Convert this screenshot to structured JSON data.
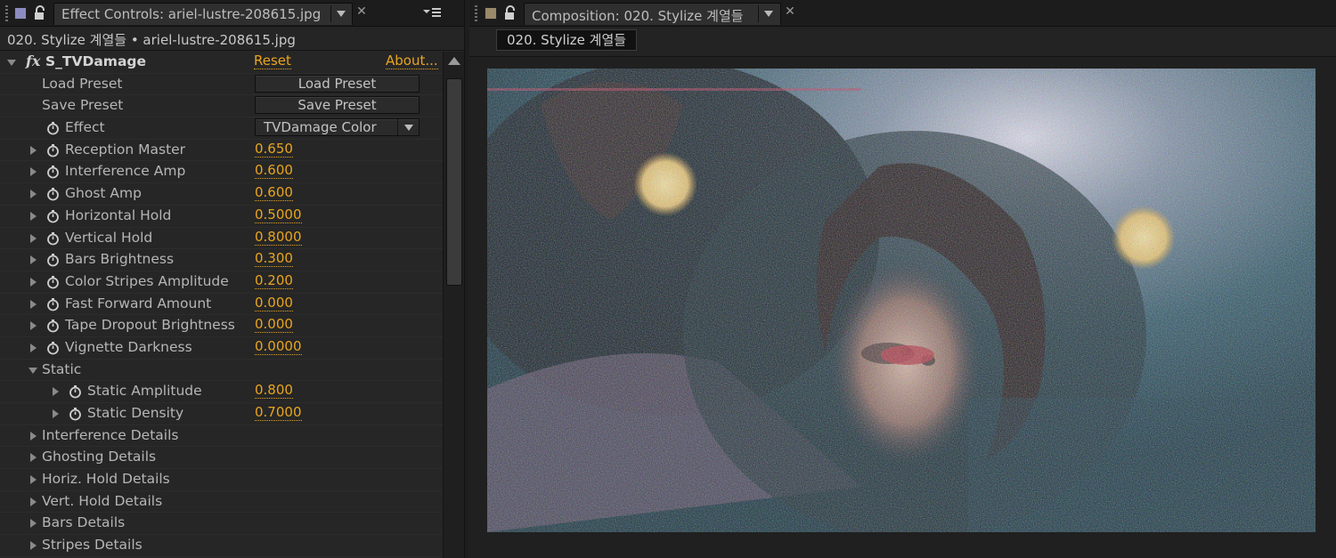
{
  "effect_controls": {
    "tab_title": "Effect Controls: ariel-lustre-208615.jpg",
    "source_line": "020. Stylize 계열들 • ariel-lustre-208615.jpg",
    "effect_name": "S_TVDamage",
    "fx_label": "fx",
    "reset_label": "Reset",
    "about_label": "About...",
    "load_preset": {
      "label": "Load Preset",
      "button": "Load Preset"
    },
    "save_preset": {
      "label": "Save Preset",
      "button": "Save Preset"
    },
    "effect_select": {
      "label": "Effect",
      "value": "TVDamage Color"
    },
    "params": [
      {
        "label": "Reception Master",
        "value": "0.650"
      },
      {
        "label": "Interference Amp",
        "value": "0.600"
      },
      {
        "label": "Ghost Amp",
        "value": "0.600"
      },
      {
        "label": "Horizontal Hold",
        "value": "0.5000"
      },
      {
        "label": "Vertical Hold",
        "value": "0.8000"
      },
      {
        "label": "Bars Brightness",
        "value": "0.300"
      },
      {
        "label": "Color Stripes Amplitude",
        "value": "0.200"
      },
      {
        "label": "Fast Forward Amount",
        "value": "0.000"
      },
      {
        "label": "Tape Dropout Brightness",
        "value": "0.000"
      },
      {
        "label": "Vignette Darkness",
        "value": "0.0000"
      }
    ],
    "static_group": {
      "label": "Static",
      "params": [
        {
          "label": "Static Amplitude",
          "value": "0.800"
        },
        {
          "label": "Static Density",
          "value": "0.7000"
        }
      ]
    },
    "detail_groups": [
      "Interference Details",
      "Ghosting Details",
      "Horiz. Hold Details",
      "Vert. Hold Details",
      "Bars Details",
      "Stripes Details"
    ]
  },
  "composition": {
    "tab_title": "Composition: 020. Stylize 계열들",
    "chip_label": "020. Stylize 계열들",
    "viewer_image": "portrait with tv-damage static noise"
  },
  "colors": {
    "value_accent": "#e8a520",
    "panel_bg": "#262626",
    "viewer_bg": "#202020",
    "left_swatch": "#8c8cc0",
    "comp_swatch": "#9a8a6a"
  }
}
